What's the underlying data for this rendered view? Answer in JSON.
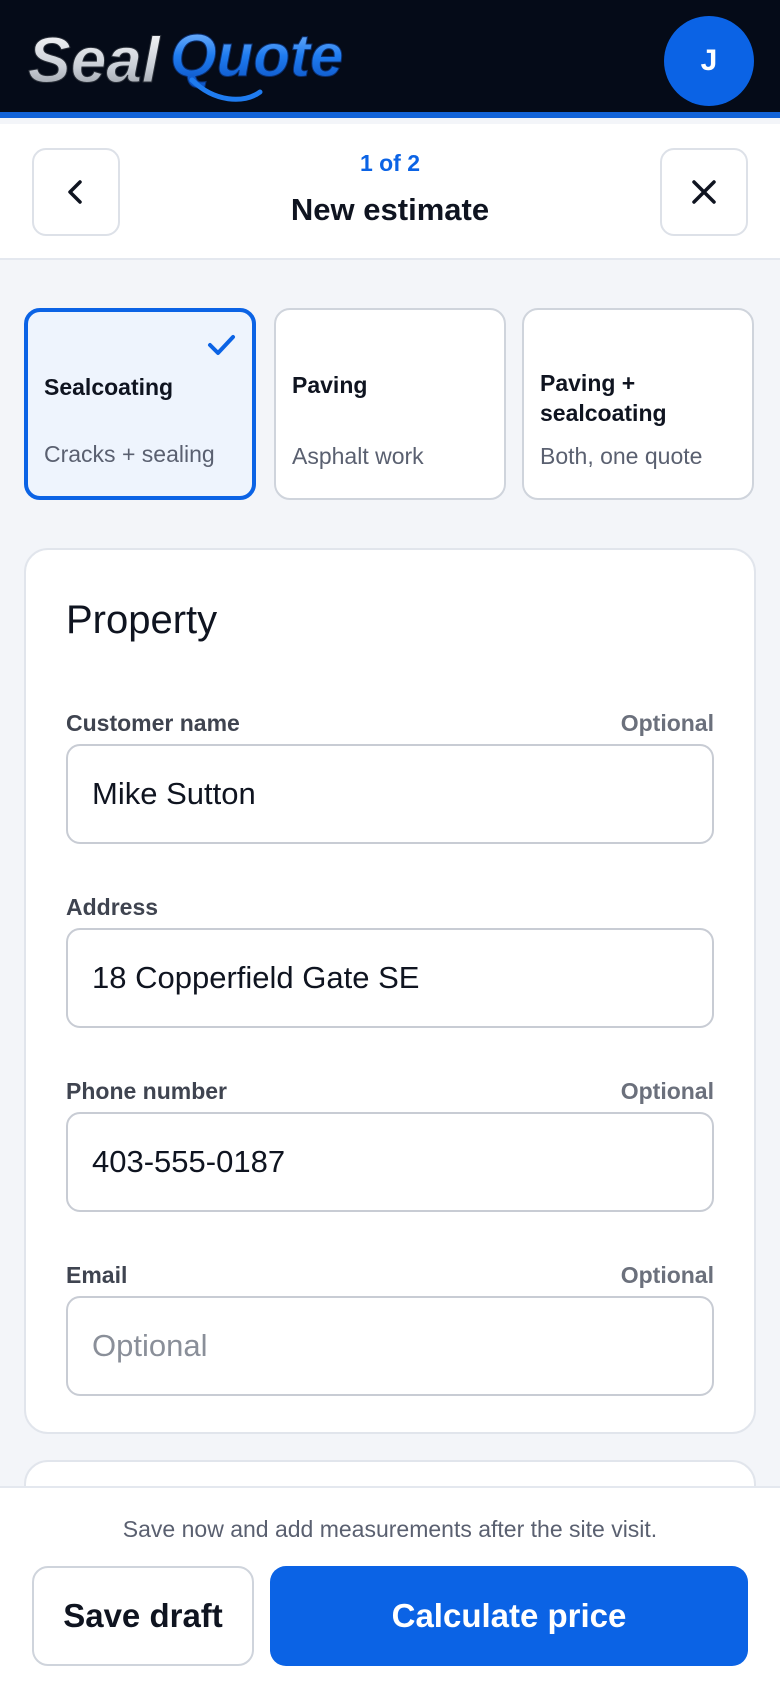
{
  "app": {
    "logo_text": "SealQuote",
    "avatar_initial": "J"
  },
  "step": {
    "count": "1 of 2",
    "title": "New estimate",
    "back_icon": "chevron-left-icon",
    "close_icon": "close-icon"
  },
  "job_types": [
    {
      "title": "Sealcoating",
      "subtitle": "Cracks + sealing",
      "selected": true
    },
    {
      "title": "Paving",
      "subtitle": "Asphalt work",
      "selected": false
    },
    {
      "title": "Paving + sealcoating",
      "subtitle": "Both, one quote",
      "selected": false
    }
  ],
  "property": {
    "title": "Property",
    "fields": [
      {
        "label": "Customer name",
        "optional_tag": "Optional",
        "value": "Mike Sutton",
        "placeholder": ""
      },
      {
        "label": "Address",
        "optional_tag": "",
        "value": "18 Copperfield Gate SE",
        "placeholder": ""
      },
      {
        "label": "Phone number",
        "optional_tag": "Optional",
        "value": "403-555-0187",
        "placeholder": ""
      },
      {
        "label": "Email",
        "optional_tag": "Optional",
        "value": "",
        "placeholder": "Optional"
      }
    ]
  },
  "footer": {
    "hint": "Save now and add measurements after the site visit.",
    "save_draft": "Save draft",
    "calculate": "Calculate price"
  },
  "colors": {
    "accent": "#0b63e5",
    "header_bg": "#050b18",
    "page_bg": "#f3f5f9"
  }
}
